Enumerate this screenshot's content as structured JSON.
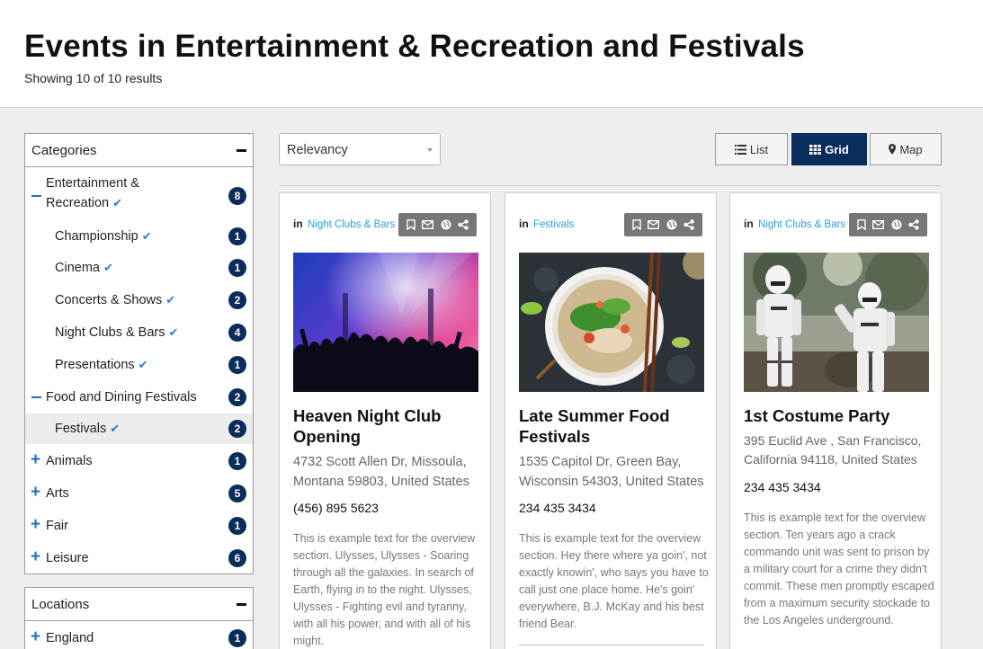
{
  "page": {
    "title": "Events in Entertainment & Recreation and Festivals",
    "results": "Showing 10 of 10 results"
  },
  "categories": {
    "title": "Categories",
    "items": [
      {
        "label": "Entertainment & Recreation",
        "count": "8",
        "level": "parent",
        "state": "expanded",
        "checked": true
      },
      {
        "label": "Championship",
        "count": "1",
        "level": "child",
        "checked": true
      },
      {
        "label": "Cinema",
        "count": "1",
        "level": "child",
        "checked": true
      },
      {
        "label": "Concerts & Shows",
        "count": "2",
        "level": "child",
        "checked": true
      },
      {
        "label": "Night Clubs & Bars",
        "count": "4",
        "level": "child",
        "checked": true
      },
      {
        "label": "Presentations",
        "count": "1",
        "level": "child",
        "checked": true
      },
      {
        "label": "Food and Dining Festivals",
        "count": "2",
        "level": "parent",
        "state": "expanded",
        "checked": false
      },
      {
        "label": "Festivals",
        "count": "2",
        "level": "child",
        "checked": true
      },
      {
        "label": "Animals",
        "count": "1",
        "level": "parent",
        "state": "collapsed"
      },
      {
        "label": "Arts",
        "count": "5",
        "level": "parent",
        "state": "collapsed"
      },
      {
        "label": "Fair",
        "count": "1",
        "level": "parent",
        "state": "collapsed"
      },
      {
        "label": "Leisure",
        "count": "6",
        "level": "parent",
        "state": "collapsed"
      }
    ]
  },
  "locations": {
    "title": "Locations",
    "items": [
      {
        "label": "England",
        "count": "1"
      }
    ]
  },
  "toolbar": {
    "sort_value": "Relevancy",
    "list_label": "List",
    "grid_label": "Grid",
    "map_label": "Map",
    "active_view": "Grid"
  },
  "colors": {
    "accent": "#0b2d5b",
    "link": "#2aa0d8",
    "plus": "#1e73be"
  },
  "cards": [
    {
      "in_label": "in",
      "category": "Night Clubs & Bars",
      "title": "Heaven Night Club Opening",
      "address": "4732 Scott Allen Dr, Missoula, Montana 59803, United States",
      "phone": "(456) 895 5623",
      "description": "This is example text for the overview section. Ulysses, Ulysses - Soaring through all the galaxies. In search of Earth, flying in to the night. Ulysses, Ulysses - Fighting evil and tyranny, with all his power, and with all of his might."
    },
    {
      "in_label": "in",
      "category": "Festivals",
      "title": "Late Summer Food Festivals",
      "address": "1535 Capitol Dr, Green Bay, Wisconsin 54303, United States",
      "phone": "234 435 3434",
      "description": "This is example text for the overview section. Hey there where ya goin', not exactly knowin', who says you have to call just one place home. He's goin' everywhere, B.J. McKay and his best friend Bear."
    },
    {
      "in_label": "in",
      "category": "Night Clubs & Bars",
      "title": "1st Costume Party",
      "address": "395 Euclid Ave , San Francisco, California 94118, United States",
      "phone": "234 435 3434",
      "description": "This is example text for the overview section. Ten years ago a crack commando unit was sent to prison by a military court for a crime they didn't commit. These men promptly escaped from a maximum security stockade to the Los Angeles underground."
    }
  ],
  "icons": [
    "bookmark-icon",
    "email-icon",
    "globe-icon",
    "share-icon",
    "list-icon",
    "grid-icon",
    "map-pin-icon",
    "check-icon",
    "plus-icon",
    "minus-icon"
  ]
}
